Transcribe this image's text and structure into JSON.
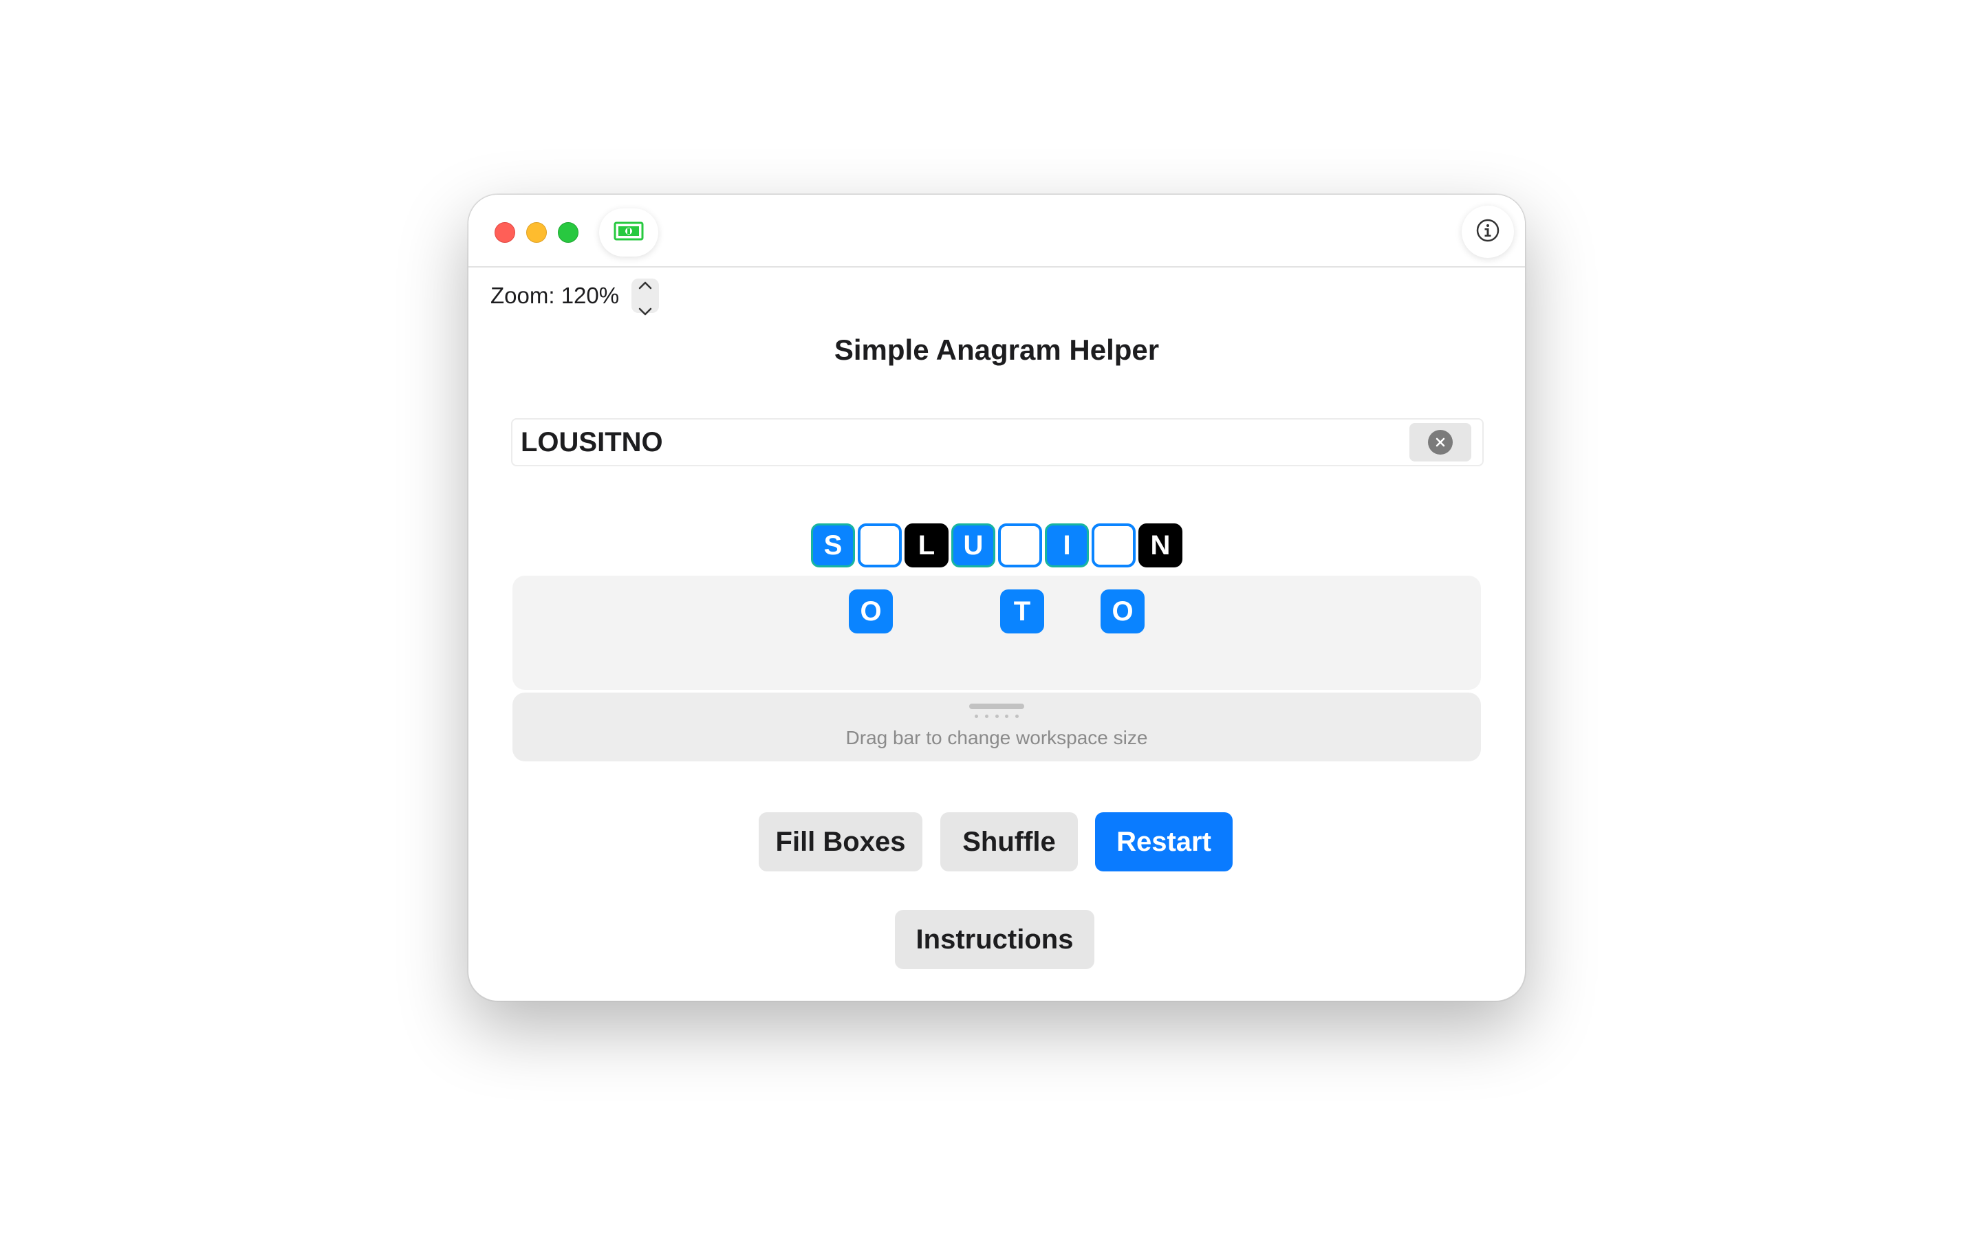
{
  "zoom": {
    "label": "Zoom: 120%"
  },
  "title": "Simple Anagram Helper",
  "word_input": {
    "value": "LOUSITNO"
  },
  "slots": [
    "S",
    "",
    "L",
    "U",
    "",
    "I",
    "",
    "N"
  ],
  "workspace_tiles": [
    "O",
    "T",
    "O"
  ],
  "drag_hint": "Drag bar to change workspace size",
  "buttons": {
    "fill_boxes": "Fill Boxes",
    "shuffle": "Shuffle",
    "restart": "Restart",
    "instructions": "Instructions"
  },
  "colors": {
    "accent": "#0a84ff",
    "slot_border": "#18b5a0",
    "locked": "#000000",
    "money_icon": "#27c93f"
  },
  "icons": {
    "toolbar_left": "money-icon",
    "toolbar_right": "info-icon",
    "clear": "clear-icon"
  }
}
